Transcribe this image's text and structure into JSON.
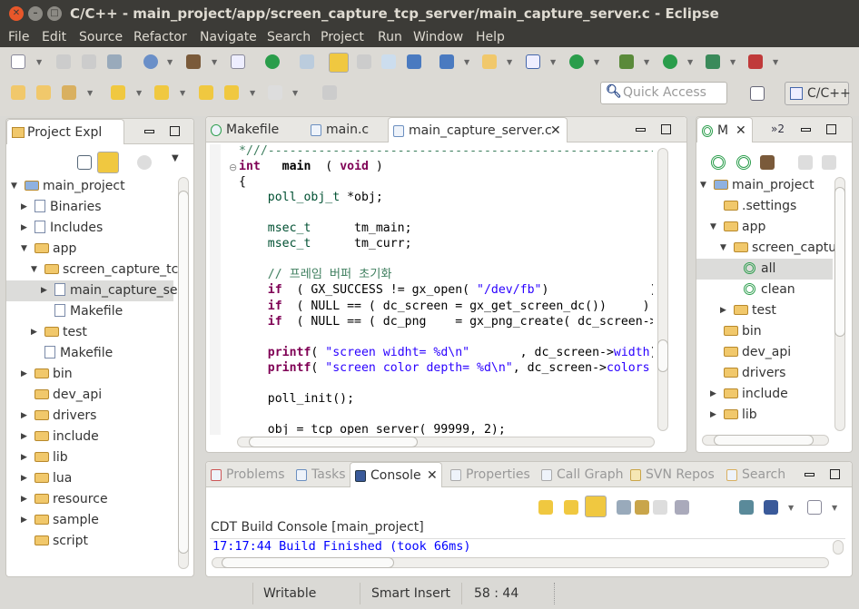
{
  "window": {
    "title": "C/C++ - main_project/app/screen_capture_tcp_server/main_capture_server.c - Eclipse"
  },
  "menu": [
    "File",
    "Edit",
    "Source",
    "Refactor",
    "Navigate",
    "Search",
    "Project",
    "Run",
    "Window",
    "Help"
  ],
  "quick_access": {
    "placeholder": "Quick Access"
  },
  "perspective": {
    "label": "C/C++"
  },
  "project_explorer": {
    "tab": "Project Expl",
    "items": [
      {
        "label": "main_project",
        "depth": 0,
        "tw": "open",
        "icon": "project"
      },
      {
        "label": "Binaries",
        "depth": 1,
        "tw": "closed",
        "icon": "binaries"
      },
      {
        "label": "Includes",
        "depth": 1,
        "tw": "closed",
        "icon": "includes"
      },
      {
        "label": "app",
        "depth": 1,
        "tw": "open",
        "icon": "folder"
      },
      {
        "label": "screen_capture_tc",
        "depth": 2,
        "tw": "open",
        "icon": "folder"
      },
      {
        "label": "main_capture_se",
        "depth": 3,
        "tw": "closed",
        "icon": "c-file",
        "selected": true
      },
      {
        "label": "Makefile",
        "depth": 3,
        "tw": "",
        "icon": "file"
      },
      {
        "label": "test",
        "depth": 2,
        "tw": "closed",
        "icon": "folder"
      },
      {
        "label": "Makefile",
        "depth": 2,
        "tw": "",
        "icon": "file"
      },
      {
        "label": "bin",
        "depth": 1,
        "tw": "closed",
        "icon": "folder"
      },
      {
        "label": "dev_api",
        "depth": 1,
        "tw": "",
        "icon": "folder"
      },
      {
        "label": "drivers",
        "depth": 1,
        "tw": "closed",
        "icon": "folder"
      },
      {
        "label": "include",
        "depth": 1,
        "tw": "closed",
        "icon": "folder"
      },
      {
        "label": "lib",
        "depth": 1,
        "tw": "closed",
        "icon": "folder"
      },
      {
        "label": "lua",
        "depth": 1,
        "tw": "closed",
        "icon": "folder"
      },
      {
        "label": "resource",
        "depth": 1,
        "tw": "closed",
        "icon": "folder"
      },
      {
        "label": "sample",
        "depth": 1,
        "tw": "closed",
        "icon": "folder"
      },
      {
        "label": "script",
        "depth": 1,
        "tw": "",
        "icon": "folder"
      }
    ]
  },
  "editor": {
    "tabs": [
      {
        "label": "Makefile"
      },
      {
        "label": "main.c"
      },
      {
        "label": "main_capture_server.c",
        "active": true
      }
    ],
    "lines": [
      [
        [
          "cm",
          "*///-----------------------------------------------------------"
        ]
      ],
      [
        [
          "kw",
          "int"
        ],
        [
          "",
          "   "
        ],
        [
          "fn",
          "main"
        ],
        [
          "",
          "  ( "
        ],
        [
          "kw",
          "void"
        ],
        [
          "",
          " )"
        ]
      ],
      [
        [
          "",
          "{"
        ]
      ],
      [
        [
          "",
          "    "
        ],
        [
          "ty",
          "poll_obj_t"
        ],
        [
          "",
          " *obj;"
        ]
      ],
      [
        [
          "",
          ""
        ]
      ],
      [
        [
          "",
          "    "
        ],
        [
          "ty",
          "msec_t"
        ],
        [
          "",
          "      tm_main;"
        ]
      ],
      [
        [
          "",
          "    "
        ],
        [
          "ty",
          "msec_t"
        ],
        [
          "",
          "      tm_curr;"
        ]
      ],
      [
        [
          "",
          ""
        ]
      ],
      [
        [
          "cm",
          "    // 프레임 버퍼 초기화"
        ]
      ],
      [
        [
          "",
          "    "
        ],
        [
          "kw",
          "if"
        ],
        [
          "",
          "  ( GX_SUCCESS != gx_open( "
        ],
        [
          "str",
          "\"/dev/fb\""
        ],
        [
          ")              )"
        ]
      ],
      [
        [
          "",
          "    "
        ],
        [
          "kw",
          "if"
        ],
        [
          "",
          "  ( NULL == ( dc_screen = gx_get_screen_dc())     )"
        ]
      ],
      [
        [
          "",
          "    "
        ],
        [
          "kw",
          "if"
        ],
        [
          "",
          "  ( NULL == ( dc_png    = gx_png_create( dc_screen->"
        ]
      ],
      [
        [
          "",
          ""
        ]
      ],
      [
        [
          "",
          "    "
        ],
        [
          "kw",
          "printf"
        ],
        [
          "",
          "( "
        ],
        [
          "str",
          "\"screen widht= %d\\n\""
        ],
        [
          "",
          "       , dc_screen->"
        ],
        [
          "str",
          "width"
        ],
        [
          ")"
        ]
      ],
      [
        [
          "",
          "    "
        ],
        [
          "kw",
          "printf"
        ],
        [
          "",
          "( "
        ],
        [
          "str",
          "\"screen color depth= %d\\n\""
        ],
        [
          "",
          ", dc_screen->"
        ],
        [
          "str",
          "colors"
        ]
      ],
      [
        [
          "",
          ""
        ]
      ],
      [
        [
          "",
          "    poll_init();"
        ]
      ],
      [
        [
          "",
          ""
        ]
      ],
      [
        [
          "",
          "    obj = tcp_open_server( 99999, 2);"
        ]
      ]
    ]
  },
  "make_targets": {
    "tab": "M",
    "overflow": "»2",
    "items": [
      {
        "label": "main_project",
        "depth": 0,
        "tw": "open",
        "icon": "project"
      },
      {
        "label": ".settings",
        "depth": 1,
        "tw": "",
        "icon": "folder"
      },
      {
        "label": "app",
        "depth": 1,
        "tw": "open",
        "icon": "folder"
      },
      {
        "label": "screen_captu",
        "depth": 2,
        "tw": "open",
        "icon": "folder"
      },
      {
        "label": "all",
        "depth": 3,
        "tw": "",
        "icon": "target",
        "selected": true
      },
      {
        "label": "clean",
        "depth": 3,
        "tw": "",
        "icon": "target"
      },
      {
        "label": "test",
        "depth": 2,
        "tw": "closed",
        "icon": "folder"
      },
      {
        "label": "bin",
        "depth": 1,
        "tw": "",
        "icon": "folder"
      },
      {
        "label": "dev_api",
        "depth": 1,
        "tw": "",
        "icon": "folder"
      },
      {
        "label": "drivers",
        "depth": 1,
        "tw": "",
        "icon": "folder"
      },
      {
        "label": "include",
        "depth": 1,
        "tw": "closed",
        "icon": "folder"
      },
      {
        "label": "lib",
        "depth": 1,
        "tw": "closed",
        "icon": "folder"
      }
    ]
  },
  "bottom": {
    "tabs": [
      {
        "label": "Problems"
      },
      {
        "label": "Tasks"
      },
      {
        "label": "Console",
        "active": true
      },
      {
        "label": "Properties"
      },
      {
        "label": "Call Graph"
      },
      {
        "label": "SVN Repos"
      },
      {
        "label": "Search"
      }
    ],
    "console_title": "CDT Build Console [main_project]",
    "output": "17:17:44 Build Finished (took 66ms)"
  },
  "status": {
    "writable": "Writable",
    "insert_mode": "Smart Insert",
    "position": "58 : 44"
  },
  "colors": {
    "keyword": "#7f0055",
    "string": "#2a00ff",
    "comment": "#3f7f5f",
    "console_text": "#0000ff",
    "titlebar": "#3c3b37"
  }
}
